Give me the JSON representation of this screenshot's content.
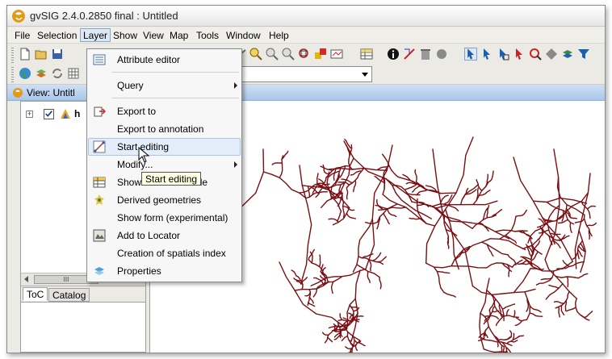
{
  "window": {
    "title": "gvSIG 2.4.0.2850 final : Untitled",
    "accent": "#e59a17"
  },
  "menubar": {
    "items": [
      "File",
      "Selection",
      "Layer",
      "Show",
      "View",
      "Map",
      "Tools",
      "Window",
      "Help"
    ],
    "active": "Layer"
  },
  "toolbar": {
    "icons_row1_left": [
      "new-icon",
      "open-icon",
      "save-icon"
    ],
    "icons_row2_left": [
      "globe-icon",
      "layers-icon",
      "refresh-icon",
      "grid-icon"
    ],
    "icons_right": [
      "lasso-select-icon",
      "zoom-in-icon",
      "zoom-out-icon",
      "pan-icon",
      "zoom-extent-icon",
      "zoom-layer-icon",
      "measure-icon",
      "table-icon",
      "info-icon",
      "hyperlink-icon",
      "delete-icon",
      "label-icon",
      "pointer-icon",
      "select-by-point-icon",
      "select-by-rect-icon",
      "select-by-polygon-icon",
      "select-by-circle-icon",
      "select-by-buffer-icon",
      "select-by-layer-icon",
      "filter-icon"
    ]
  },
  "view": {
    "title": "View: Untitl"
  },
  "toc": {
    "layer_name": "h",
    "checked": true,
    "scroll_thumb_label": "III",
    "tabs": [
      "ToC",
      "Catalog"
    ],
    "active_tab": "ToC"
  },
  "layer_menu": {
    "items": [
      {
        "label": "Attribute editor",
        "icon": "attribute-editor-icon",
        "submenu": false
      },
      {
        "label": "Query",
        "icon": "",
        "submenu": true
      },
      {
        "label": "Export to",
        "icon": "export-icon",
        "submenu": false
      },
      {
        "label": "Export to annotation",
        "icon": "",
        "submenu": false
      },
      {
        "label": "Start editing",
        "icon": "start-editing-icon",
        "submenu": false,
        "hover": true
      },
      {
        "label": "Modify...",
        "icon": "",
        "submenu": true
      },
      {
        "label": "Show attributes table",
        "icon": "table-icon",
        "submenu": false
      },
      {
        "label": "Derived geometries",
        "icon": "derived-geometries-icon",
        "submenu": false
      },
      {
        "label": "Show form (experimental)",
        "icon": "",
        "submenu": false
      },
      {
        "label": "Add to Locator",
        "icon": "locator-icon",
        "submenu": false
      },
      {
        "label": "Creation of spatials index",
        "icon": "",
        "submenu": false
      },
      {
        "label": "Properties",
        "icon": "properties-icon",
        "submenu": false
      }
    ]
  },
  "tooltip": {
    "text": "Start editing"
  },
  "map": {
    "line_color": "#7a0e12"
  }
}
